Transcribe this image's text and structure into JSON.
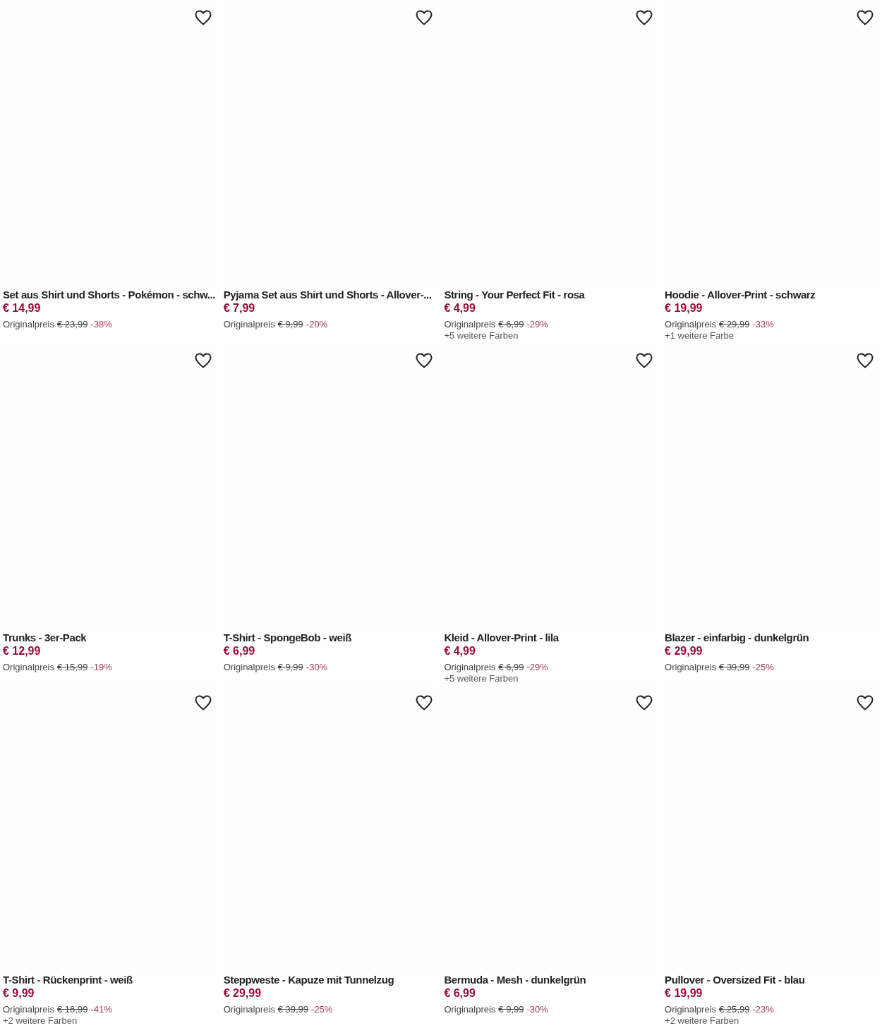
{
  "products": [
    {
      "title": "Set aus Shirt und Shorts - Pokémon - schw...",
      "price": "€ 14,99",
      "original_label": "Originalpreis",
      "original_price": "€ 23,99",
      "discount": "-38%"
    },
    {
      "title": "Pyjama Set aus Shirt und Shorts - Allover-...",
      "price": "€ 7,99",
      "original_label": "Originalpreis",
      "original_price": "€ 9,99",
      "discount": "-20%"
    },
    {
      "title": "String - Your Perfect Fit - rosa",
      "price": "€ 4,99",
      "original_label": "Originalpreis",
      "original_price": "€ 6,99",
      "discount": "-29%",
      "more_colors": "+5 weitere Farben"
    },
    {
      "title": "Hoodie - Allover-Print - schwarz",
      "price": "€ 19,99",
      "original_label": "Originalpreis",
      "original_price": "€ 29,99",
      "discount": "-33%",
      "more_colors": "+1 weitere Farbe"
    },
    {
      "title": "Trunks - 3er-Pack",
      "price": "€ 12,99",
      "original_label": "Originalpreis",
      "original_price": "€ 15,99",
      "discount": "-19%"
    },
    {
      "title": "T-Shirt - SpongeBob - weiß",
      "price": "€ 6,99",
      "original_label": "Originalpreis",
      "original_price": "€ 9,99",
      "discount": "-30%"
    },
    {
      "title": "Kleid - Allover-Print - lila",
      "price": "€ 4,99",
      "original_label": "Originalpreis",
      "original_price": "€ 6,99",
      "discount": "-29%",
      "more_colors": "+5 weitere Farben"
    },
    {
      "title": "Blazer - einfarbig - dunkelgrün",
      "price": "€ 29,99",
      "original_label": "Originalpreis",
      "original_price": "€ 39,99",
      "discount": "-25%"
    },
    {
      "title": "T-Shirt - Rückenprint - weiß",
      "price": "€ 9,99",
      "original_label": "Originalpreis",
      "original_price": "€ 16,99",
      "discount": "-41%",
      "more_colors": "+2 weitere Farben"
    },
    {
      "title": "Steppweste - Kapuze mit Tunnelzug",
      "price": "€ 29,99",
      "original_label": "Originalpreis",
      "original_price": "€ 39,99",
      "discount": "-25%"
    },
    {
      "title": "Bermuda - Mesh - dunkelgrün",
      "price": "€ 6,99",
      "original_label": "Originalpreis",
      "original_price": "€ 9,99",
      "discount": "-30%"
    },
    {
      "title": "Pullover - Oversized Fit - blau",
      "price": "€ 19,99",
      "original_label": "Originalpreis",
      "original_price": "€ 25,99",
      "discount": "-23%",
      "more_colors": "+2 weitere Farben"
    }
  ]
}
